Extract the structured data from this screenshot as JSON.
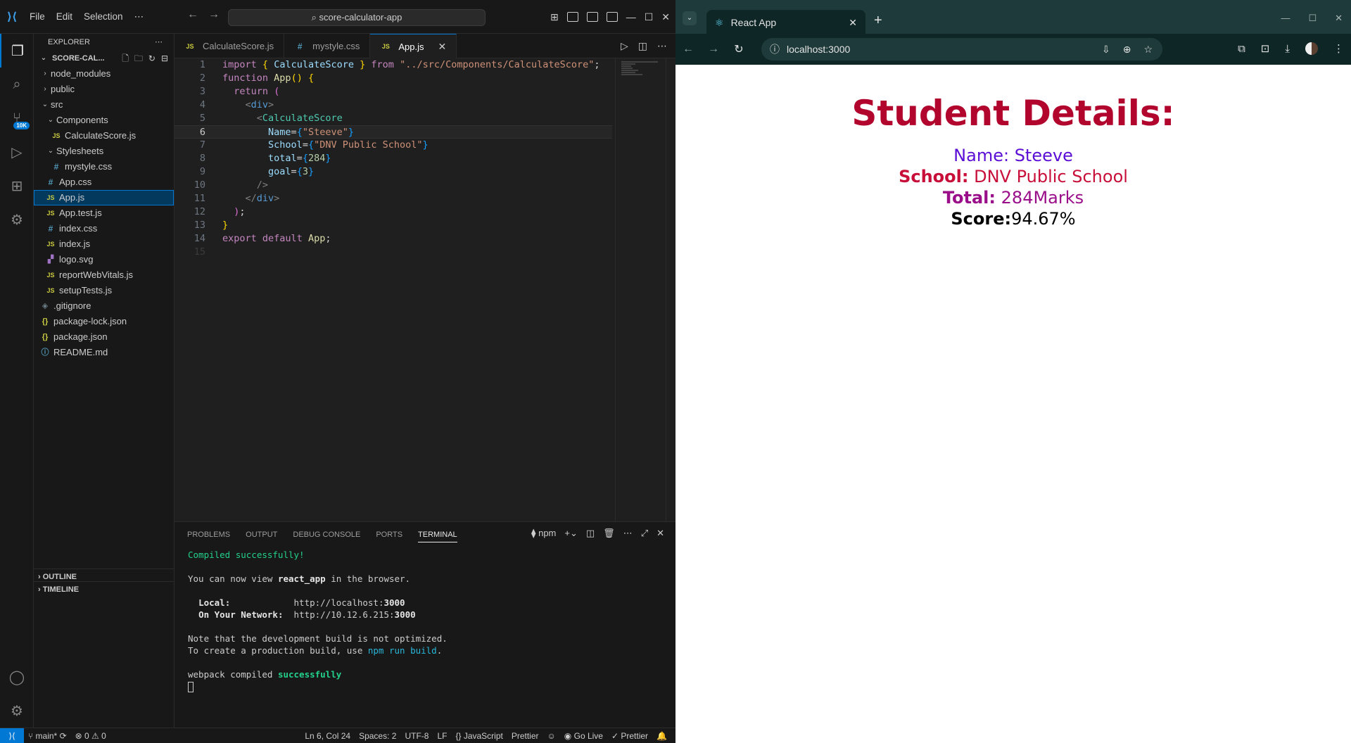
{
  "vscode": {
    "menu": [
      "File",
      "Edit",
      "Selection",
      "⋯"
    ],
    "command_center": "⌕ score-calculator-app",
    "sidebar": {
      "title": "EXPLORER",
      "project": "SCORE-CAL...",
      "tree": [
        {
          "label": "node_modules",
          "type": "folder",
          "depth": 0,
          "collapsed": true
        },
        {
          "label": "public",
          "type": "folder",
          "depth": 0,
          "collapsed": true
        },
        {
          "label": "src",
          "type": "folder",
          "depth": 0,
          "collapsed": false
        },
        {
          "label": "Components",
          "type": "folder",
          "depth": 1,
          "collapsed": false
        },
        {
          "label": "CalculateScore.js",
          "type": "js",
          "depth": 2
        },
        {
          "label": "Stylesheets",
          "type": "folder",
          "depth": 1,
          "collapsed": false
        },
        {
          "label": "mystyle.css",
          "type": "css",
          "depth": 2
        },
        {
          "label": "App.css",
          "type": "css",
          "depth": 1
        },
        {
          "label": "App.js",
          "type": "js",
          "depth": 1,
          "selected": true
        },
        {
          "label": "App.test.js",
          "type": "js",
          "depth": 1
        },
        {
          "label": "index.css",
          "type": "css",
          "depth": 1
        },
        {
          "label": "index.js",
          "type": "js",
          "depth": 1
        },
        {
          "label": "logo.svg",
          "type": "svg",
          "depth": 1
        },
        {
          "label": "reportWebVitals.js",
          "type": "js",
          "depth": 1
        },
        {
          "label": "setupTests.js",
          "type": "js",
          "depth": 1
        },
        {
          "label": ".gitignore",
          "type": "git",
          "depth": 0
        },
        {
          "label": "package-lock.json",
          "type": "json",
          "depth": 0
        },
        {
          "label": "package.json",
          "type": "json",
          "depth": 0
        },
        {
          "label": "README.md",
          "type": "md",
          "depth": 0
        }
      ],
      "outline": "OUTLINE",
      "timeline": "TIMELINE"
    },
    "badge": "10K",
    "tabs": [
      {
        "label": "CalculateScore.js",
        "icon": "JS"
      },
      {
        "label": "mystyle.css",
        "icon": "#"
      },
      {
        "label": "App.js",
        "icon": "JS",
        "active": true
      }
    ],
    "code_lines": [
      "import { CalculateScore } from \"../src/Components/CalculateScore\";",
      "function App() {",
      "  return (",
      "    <div>",
      "      <CalculateScore",
      "        Name={\"Steeve\"}",
      "        School={\"DNV Public School\"}",
      "        total={284}",
      "        goal={3}",
      "      />",
      "    </div>",
      "  );",
      "}",
      "export default App;",
      ""
    ],
    "current_line": 6,
    "panel": {
      "tabs": [
        "PROBLEMS",
        "OUTPUT",
        "DEBUG CONSOLE",
        "PORTS",
        "TERMINAL"
      ],
      "active_tab": "TERMINAL",
      "shell": "npm",
      "terminal": {
        "compiled": "Compiled successfully!",
        "view_pre": "You can now view ",
        "app_name": "react_app",
        "view_post": " in the browser.",
        "local_label": "Local:",
        "local_url_pre": "http://localhost:",
        "local_port": "3000",
        "network_label": "On Your Network:",
        "network_url_pre": "http://10.12.6.215:",
        "network_port": "3000",
        "note1": "Note that the development build is not optimized.",
        "note2_pre": "To create a production build, use ",
        "note2_cmd": "npm run build",
        "note2_post": ".",
        "webpack_pre": "webpack compiled ",
        "webpack_ok": "successfully"
      }
    },
    "status": {
      "branch": "main*",
      "sync": "⟳",
      "problems": "⊗ 0 ⚠ 0",
      "position": "Ln 6, Col 24",
      "spaces": "Spaces: 2",
      "encoding": "UTF-8",
      "eol": "LF",
      "language": "{} JavaScript",
      "prettier": "Prettier",
      "golive": "Go Live",
      "prettier2": "✓ Prettier"
    }
  },
  "browser": {
    "tab_title": "React App",
    "url": "localhost:3000",
    "page": {
      "heading": "Student Details:",
      "name_label": "Name:",
      "name_value": "Steeve",
      "school_label": "School:",
      "school_value": "DNV Public School",
      "total_label": "Total:",
      "total_value": "284Marks",
      "score_label": "Score:",
      "score_value": "94.67%"
    }
  }
}
